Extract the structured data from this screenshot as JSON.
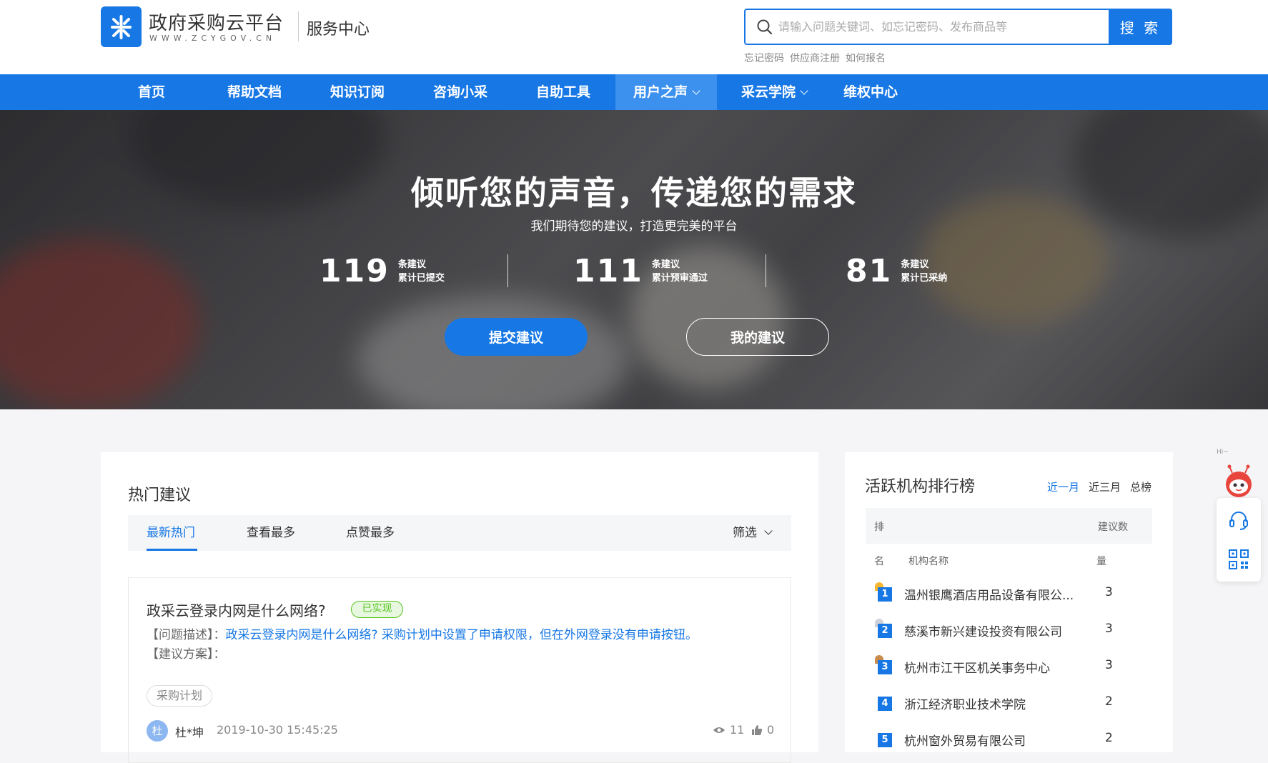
{
  "header": {
    "logo_name": "政府采购云平台",
    "logo_url": "WWW.ZCYGOV.CN",
    "service_center": "服务中心",
    "search": {
      "placeholder": "请输入问题关键词、如忘记密码、发布商品等",
      "button": "搜 索"
    },
    "quick_links": [
      "忘记密码",
      "供应商注册",
      "如何报名"
    ]
  },
  "nav": {
    "items": [
      {
        "label": "首页",
        "dropdown": false,
        "active": false
      },
      {
        "label": "帮助文档",
        "dropdown": false,
        "active": false
      },
      {
        "label": "知识订阅",
        "dropdown": false,
        "active": false
      },
      {
        "label": "咨询小采",
        "dropdown": false,
        "active": false
      },
      {
        "label": "自助工具",
        "dropdown": false,
        "active": false
      },
      {
        "label": "用户之声",
        "dropdown": true,
        "active": true
      },
      {
        "label": "采云学院",
        "dropdown": true,
        "active": false
      },
      {
        "label": "维权中心",
        "dropdown": false,
        "active": false
      }
    ]
  },
  "hero": {
    "title": "倾听您的声音，传递您的需求",
    "subtitle": "我们期待您的建议，打造更完美的平台",
    "stats": [
      {
        "value": "119",
        "unit": "条建议",
        "label": "累计已提交"
      },
      {
        "value": "111",
        "unit": "条建议",
        "label": "累计预审通过"
      },
      {
        "value": "81",
        "unit": "条建议",
        "label": "累计已采纳"
      }
    ],
    "submit_button": "提交建议",
    "mine_button": "我的建议"
  },
  "hot": {
    "title": "热门建议",
    "tabs": [
      "最新热门",
      "查看最多",
      "点赞最多"
    ],
    "active_tab": "最新热门",
    "filter": "筛选",
    "cards": [
      {
        "title": "政采云登录内网是什么网络?",
        "status": "已实现",
        "desc_label": "【问题描述】：",
        "desc_text": "政采云登录内网是什么网络? 采购计划中设置了申请权限，但在外网登录没有申请按钮。",
        "plan_label": "【建议方案】：",
        "tag": "采购计划",
        "avatar": "杜",
        "user": "杜*坤",
        "time": "2019-10-30 15:45:25",
        "views": "11",
        "likes": "0"
      }
    ]
  },
  "rank": {
    "title": "活跃机构排行榜",
    "periods": [
      "近一月",
      "近三月",
      "总榜"
    ],
    "active_period": "近一月",
    "head_rank_top": "排",
    "head_count_top": "建议数",
    "head_rank_bottom": "名",
    "head_name": "机构名称",
    "head_count_bottom": "量",
    "rows": [
      {
        "rank": "1",
        "name": "温州银鹰酒店用品设备有限公...",
        "count": "3"
      },
      {
        "rank": "2",
        "name": "慈溪市新兴建设投资有限公司",
        "count": "3"
      },
      {
        "rank": "3",
        "name": "杭州市江干区机关事务中心",
        "count": "3"
      },
      {
        "rank": "4",
        "name": "浙江经济职业技术学院",
        "count": "2"
      },
      {
        "rank": "5",
        "name": "杭州窗外贸易有限公司",
        "count": "2"
      }
    ]
  },
  "float": {
    "hi": "Hi~"
  },
  "colors": {
    "brand": "#1677e5",
    "nav_active": "#3c91ef",
    "success": "#52c41a",
    "gold": "#f5b82e",
    "silver": "#cfd3d8",
    "bronze": "#c98a4b"
  }
}
